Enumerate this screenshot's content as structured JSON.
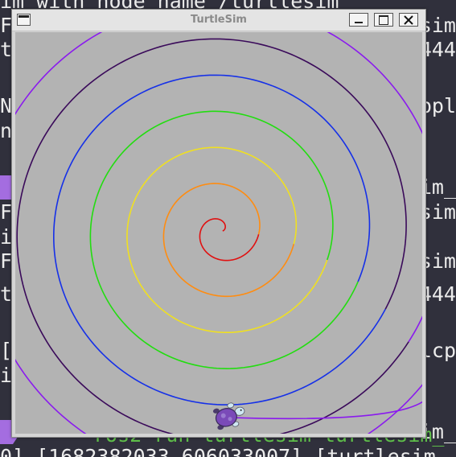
{
  "window": {
    "title": "TurtleSim",
    "background": "#b3b3b3",
    "titlebar_color": "#e4e4e4"
  },
  "terminal": {
    "background": "#30303c",
    "accent": "#a46de0",
    "lines": [
      {
        "left": "im with node name /turtlesim",
        "right": ""
      },
      {
        "left": "FO",
        "right": "esim"
      },
      {
        "left": "t",
        "right": "4444"
      },
      {
        "left": "",
        "right": ""
      },
      {
        "left": "N",
        "right": "ppl"
      },
      {
        "left": "n",
        "right": ""
      },
      {
        "left": "",
        "right": ""
      },
      {
        "left": "",
        "right": "im_"
      },
      {
        "left": "FO",
        "right": "esim"
      },
      {
        "left": "im",
        "right": ""
      },
      {
        "left": "FO",
        "right": "esim"
      },
      {
        "left": "t",
        "right": "4444"
      },
      {
        "left": "",
        "right": ""
      },
      {
        "left": "[",
        "right": "lcp"
      },
      {
        "left": "i",
        "right": ""
      },
      {
        "left": "",
        "right": ""
      },
      {
        "left": "",
        "right": "im_"
      },
      {
        "left": "0] [1682382033.606033007] [turtlesim",
        "right": ""
      }
    ],
    "bottom_command": "ros2 run turtlesim turtlesim_"
  },
  "spiral": {
    "center_x": 5.6,
    "center_y": 5.6,
    "growth_per_turn": 1.0,
    "start_radius": 0.05,
    "turns": 6.9,
    "color_bands": [
      "#e01010",
      "#ff8c10",
      "#f0e020",
      "#22dd10",
      "#1530e8",
      "#3a0a5a",
      "#8a1aee"
    ]
  },
  "turtle": {
    "x": 5.75,
    "y": 0.45,
    "shell_color": "#7a4ab8",
    "body_color": "#cfe8f2"
  }
}
